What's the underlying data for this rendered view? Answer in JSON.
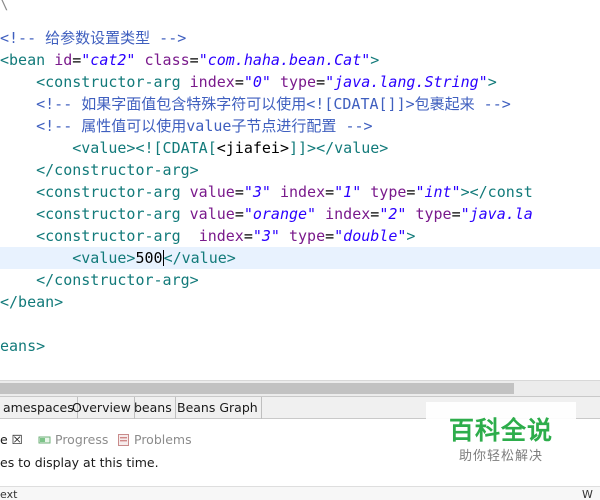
{
  "editor": {
    "top_mark": "\\",
    "lines": [
      {
        "id": "line-comment-param-type",
        "current": false,
        "tokens": [
          {
            "t": "<!-- 给参数设置类型 -->",
            "c": "cmt"
          }
        ]
      },
      {
        "id": "line-bean-open",
        "current": false,
        "tokens": [
          {
            "t": "<bean ",
            "c": "tag"
          },
          {
            "t": "id",
            "c": "attr"
          },
          {
            "t": "=",
            "c": "txt"
          },
          {
            "t": "\"cat2\"",
            "c": "val"
          },
          {
            "t": " ",
            "c": "txt"
          },
          {
            "t": "class",
            "c": "attr"
          },
          {
            "t": "=",
            "c": "txt"
          },
          {
            "t": "\"com.haha.bean.Cat\"",
            "c": "val"
          },
          {
            "t": ">",
            "c": "tag"
          }
        ]
      },
      {
        "id": "line-constructor-arg-0",
        "current": false,
        "tokens": [
          {
            "t": "    ",
            "c": "txt"
          },
          {
            "t": "<constructor-arg ",
            "c": "tag"
          },
          {
            "t": "index",
            "c": "attr"
          },
          {
            "t": "=",
            "c": "txt"
          },
          {
            "t": "\"0\"",
            "c": "val"
          },
          {
            "t": " ",
            "c": "txt"
          },
          {
            "t": "type",
            "c": "attr"
          },
          {
            "t": "=",
            "c": "txt"
          },
          {
            "t": "\"java.lang.String\"",
            "c": "val"
          },
          {
            "t": ">",
            "c": "tag"
          }
        ]
      },
      {
        "id": "line-comment-cdata",
        "current": false,
        "tokens": [
          {
            "t": "    <!-- 如果字面值包含特殊字符可以使用<![CDATA[]]>包裹起来 -->",
            "c": "cmt"
          }
        ]
      },
      {
        "id": "line-comment-value-node",
        "current": false,
        "tokens": [
          {
            "t": "    <!-- 属性值可以使用value子节点进行配置 -->",
            "c": "cmt"
          }
        ]
      },
      {
        "id": "line-value-cdata",
        "current": false,
        "tokens": [
          {
            "t": "        ",
            "c": "txt"
          },
          {
            "t": "<value>",
            "c": "tag"
          },
          {
            "t": "<![CDATA[",
            "c": "tag"
          },
          {
            "t": "<jiafei>",
            "c": "txt"
          },
          {
            "t": "]]>",
            "c": "tag"
          },
          {
            "t": "</value>",
            "c": "tag"
          }
        ]
      },
      {
        "id": "line-constructor-arg-close-1",
        "current": false,
        "tokens": [
          {
            "t": "    ",
            "c": "txt"
          },
          {
            "t": "</constructor-arg>",
            "c": "tag"
          }
        ]
      },
      {
        "id": "line-constructor-arg-1",
        "current": false,
        "tokens": [
          {
            "t": "    ",
            "c": "txt"
          },
          {
            "t": "<constructor-arg ",
            "c": "tag"
          },
          {
            "t": "value",
            "c": "attr"
          },
          {
            "t": "=",
            "c": "txt"
          },
          {
            "t": "\"3\"",
            "c": "val"
          },
          {
            "t": " ",
            "c": "txt"
          },
          {
            "t": "index",
            "c": "attr"
          },
          {
            "t": "=",
            "c": "txt"
          },
          {
            "t": "\"1\"",
            "c": "val"
          },
          {
            "t": " ",
            "c": "txt"
          },
          {
            "t": "type",
            "c": "attr"
          },
          {
            "t": "=",
            "c": "txt"
          },
          {
            "t": "\"int\"",
            "c": "val"
          },
          {
            "t": ">",
            "c": "tag"
          },
          {
            "t": "</const",
            "c": "tag"
          }
        ]
      },
      {
        "id": "line-constructor-arg-2",
        "current": false,
        "tokens": [
          {
            "t": "    ",
            "c": "txt"
          },
          {
            "t": "<constructor-arg ",
            "c": "tag"
          },
          {
            "t": "value",
            "c": "attr"
          },
          {
            "t": "=",
            "c": "txt"
          },
          {
            "t": "\"orange\"",
            "c": "val"
          },
          {
            "t": " ",
            "c": "txt"
          },
          {
            "t": "index",
            "c": "attr"
          },
          {
            "t": "=",
            "c": "txt"
          },
          {
            "t": "\"2\"",
            "c": "val"
          },
          {
            "t": " ",
            "c": "txt"
          },
          {
            "t": "type",
            "c": "attr"
          },
          {
            "t": "=",
            "c": "txt"
          },
          {
            "t": "\"java.la",
            "c": "val"
          }
        ]
      },
      {
        "id": "line-constructor-arg-3",
        "current": false,
        "tokens": [
          {
            "t": "    ",
            "c": "txt"
          },
          {
            "t": "<constructor-arg  ",
            "c": "tag"
          },
          {
            "t": "index",
            "c": "attr"
          },
          {
            "t": "=",
            "c": "txt"
          },
          {
            "t": "\"3\"",
            "c": "val"
          },
          {
            "t": " ",
            "c": "txt"
          },
          {
            "t": "type",
            "c": "attr"
          },
          {
            "t": "=",
            "c": "txt"
          },
          {
            "t": "\"double\"",
            "c": "val"
          },
          {
            "t": ">",
            "c": "tag"
          }
        ]
      },
      {
        "id": "line-value-500",
        "current": true,
        "tokens": [
          {
            "t": "        ",
            "c": "txt"
          },
          {
            "t": "<value>",
            "c": "tag"
          },
          {
            "t": "500",
            "c": "txt"
          },
          {
            "t": "",
            "c": "cursor"
          },
          {
            "t": "</value>",
            "c": "tag"
          }
        ]
      },
      {
        "id": "line-constructor-arg-close-2",
        "current": false,
        "tokens": [
          {
            "t": "    ",
            "c": "txt"
          },
          {
            "t": "</constructor-arg>",
            "c": "tag"
          }
        ]
      },
      {
        "id": "line-bean-close",
        "current": false,
        "tokens": [
          {
            "t": "</bean>",
            "c": "tag"
          }
        ]
      },
      {
        "id": "line-blank",
        "current": false,
        "tokens": [
          {
            "t": "",
            "c": "txt"
          }
        ]
      },
      {
        "id": "line-beans-close",
        "current": false,
        "tokens": [
          {
            "t": "eans>",
            "c": "tag"
          }
        ]
      }
    ]
  },
  "page_tabs": [
    {
      "id": "tab-namespaces",
      "label": "amespaces"
    },
    {
      "id": "tab-overview",
      "label": "Overview"
    },
    {
      "id": "tab-beans",
      "label": "beans"
    },
    {
      "id": "tab-beans-graph",
      "label": "Beans Graph"
    }
  ],
  "view_tabs": [
    {
      "id": "view-tab-console",
      "label": "e ☒",
      "dim": false,
      "icon": ""
    },
    {
      "id": "view-tab-progress",
      "label": "Progress",
      "dim": true,
      "icon": "progress-icon"
    },
    {
      "id": "view-tab-problems",
      "label": "Problems",
      "dim": true,
      "icon": "problems-icon"
    }
  ],
  "views": {
    "empty_message": "es to display at this time.",
    "column_header_left": "ext",
    "column_header_right": "W"
  },
  "watermark": {
    "title": "百科全说",
    "subtitle": "助你轻松解决"
  },
  "colors": {
    "tag": "#127a7a",
    "attribute": "#7a1a8c",
    "value": "#2a00ff",
    "comment": "#3f5fbf",
    "current_line": "#e8f2fe",
    "watermark_green": "#2dad4b"
  }
}
